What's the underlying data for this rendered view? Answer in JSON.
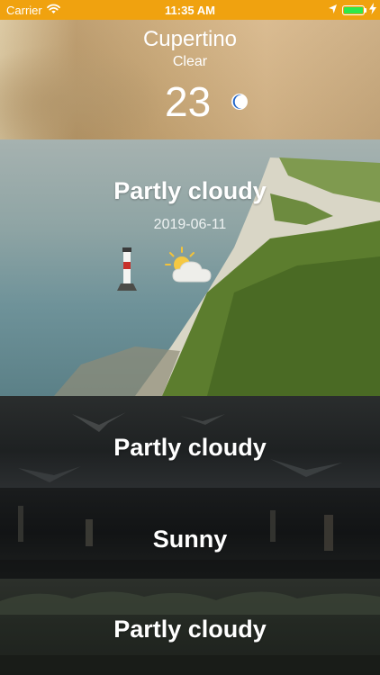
{
  "status_bar": {
    "carrier": "Carrier",
    "time": "11:35 AM",
    "wifi_icon": "wifi-icon",
    "location_icon": "location-arrow-icon",
    "charging_icon": "bolt-icon",
    "battery_level": 1.0,
    "battery_color": "#2ee84a",
    "background_color": "#f0a20f"
  },
  "current_weather": {
    "city": "Cupertino",
    "condition": "Clear",
    "temperature": "23",
    "icon": "moon-icon"
  },
  "forecast": [
    {
      "condition": "Partly cloudy",
      "date": "2019-06-11",
      "icon": "partly-cloudy-icon"
    },
    {
      "condition": "Partly cloudy"
    },
    {
      "condition": "Sunny"
    },
    {
      "condition": "Partly cloudy"
    }
  ]
}
